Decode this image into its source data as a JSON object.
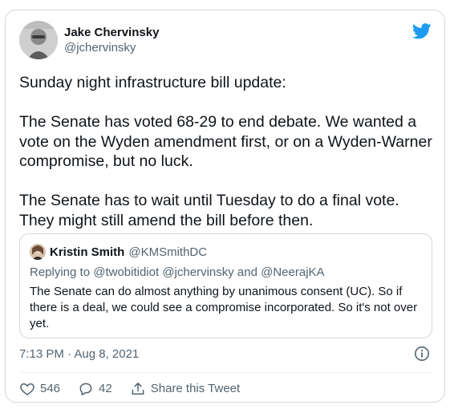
{
  "author": {
    "name": "Jake Chervinsky",
    "handle": "@jchervinsky"
  },
  "tweet": {
    "text": "Sunday night infrastructure bill update:\n\nThe Senate has voted 68-29 to end debate. We wanted a vote on the Wyden amendment first, or on a Wyden-Warner compromise, but no luck.\n\nThe Senate has to wait until Tuesday to do a final vote. They might still amend the bill before then.",
    "timestamp": "7:13 PM · Aug 8, 2021"
  },
  "quoted": {
    "name": "Kristin Smith",
    "handle": "@KMSmithDC",
    "reply_prefix": "Replying to",
    "reply_to": [
      "@twobitidiot",
      "@jchervinsky",
      "@NeerajKA"
    ],
    "reply_joiner": "and",
    "text": "The Senate can do almost anything by unanimous consent (UC). So if there is a deal, we could see a compromise incorporated. So it's not over yet."
  },
  "actions": {
    "likes": "546",
    "replies": "42",
    "share_label": "Share this Tweet"
  },
  "icons": {
    "brand": "twitter-bird-icon",
    "info": "info-icon",
    "like": "heart-icon",
    "reply": "speech-bubble-icon",
    "share": "share-upload-icon"
  },
  "colors": {
    "brand": "#1d9bf0",
    "text": "#0f1419",
    "muted": "#536471",
    "border": "#cfd9de"
  }
}
